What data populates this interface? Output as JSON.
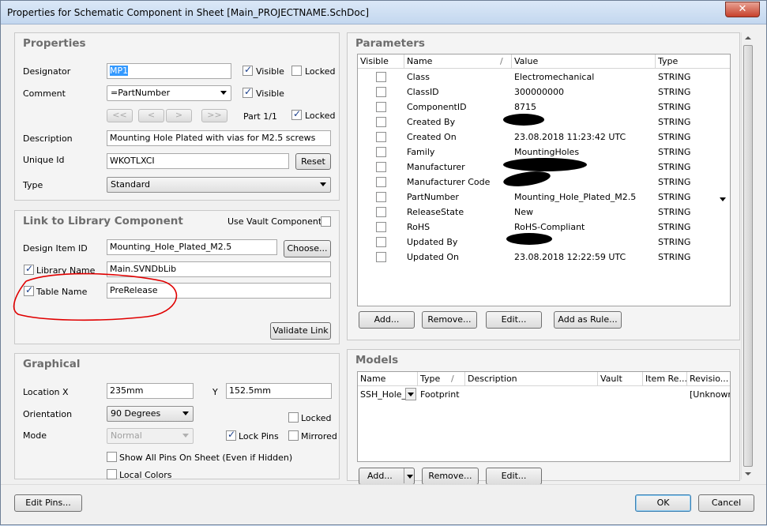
{
  "window": {
    "title": "Properties for Schematic Component in Sheet [Main_PROJECTNAME.SchDoc]",
    "close": "✕"
  },
  "properties": {
    "title": "Properties",
    "designator_label": "Designator",
    "designator_value": "MP1",
    "visible_label": "Visible",
    "locked_label": "Locked",
    "comment_label": "Comment",
    "comment_value": "=PartNumber",
    "nav": [
      "<<",
      "<",
      ">",
      ">>"
    ],
    "part_label": "Part 1/1",
    "description_label": "Description",
    "description_value": "Mounting Hole Plated with vias for M2.5 screws",
    "uniqueid_label": "Unique Id",
    "uniqueid_value": "WKOTLXCI",
    "reset": "Reset",
    "type_label": "Type",
    "type_value": "Standard"
  },
  "library": {
    "title": "Link to Library Component",
    "use_vault": "Use Vault Component",
    "design_item_label": "Design Item ID",
    "design_item_value": "Mounting_Hole_Plated_M2.5",
    "choose": "Choose...",
    "library_name_label": "Library Name",
    "library_name_value": "Main.SVNDbLib",
    "table_name_label": "Table Name",
    "table_name_value": "PreRelease",
    "validate": "Validate Link"
  },
  "graphical": {
    "title": "Graphical",
    "location_label": "Location",
    "x_label": "X",
    "x_value": "235mm",
    "y_label": "Y",
    "y_value": "152.5mm",
    "orientation_label": "Orientation",
    "orientation_value": "90 Degrees",
    "locked_label": "Locked",
    "mode_label": "Mode",
    "mode_value": "Normal",
    "lockpins_label": "Lock Pins",
    "mirrored_label": "Mirrored",
    "showpins_label": "Show All Pins On Sheet (Even if Hidden)",
    "localcolors_label": "Local Colors"
  },
  "parameters": {
    "title": "Parameters",
    "columns": [
      "Visible",
      "Name",
      "Value",
      "Type"
    ],
    "sort_indicator": "/",
    "rows": [
      {
        "name": "Class",
        "value": "Electromechanical",
        "type": "STRING"
      },
      {
        "name": "ClassID",
        "value": "300000000",
        "type": "STRING"
      },
      {
        "name": "ComponentID",
        "value": "8715",
        "type": "STRING"
      },
      {
        "name": "Created By",
        "value": "",
        "type": "STRING"
      },
      {
        "name": "Created On",
        "value": "23.08.2018 11:23:42 UTC",
        "type": "STRING"
      },
      {
        "name": "Family",
        "value": "MountingHoles",
        "type": "STRING"
      },
      {
        "name": "Manufacturer",
        "value": "",
        "type": "STRING"
      },
      {
        "name": "Manufacturer Code",
        "value": "",
        "type": "STRING"
      },
      {
        "name": "PartNumber",
        "value": "Mounting_Hole_Plated_M2.5",
        "type": "STRING"
      },
      {
        "name": "ReleaseState",
        "value": "New",
        "type": "STRING"
      },
      {
        "name": "RoHS",
        "value": "RoHS-Compliant",
        "type": "STRING"
      },
      {
        "name": "Updated By",
        "value": "",
        "type": "STRING"
      },
      {
        "name": "Updated On",
        "value": "23.08.2018 12:22:59 UTC",
        "type": "STRING"
      }
    ],
    "buttons": [
      "Add...",
      "Remove...",
      "Edit...",
      "Add as Rule..."
    ]
  },
  "models": {
    "title": "Models",
    "columns": [
      "Name",
      "Type",
      "Description",
      "Vault",
      "Item Re...",
      "Revisio..."
    ],
    "sort_indicator": "/",
    "rows": [
      {
        "name": "SSH_Hole_F",
        "type": "Footprint",
        "description": "",
        "vault": "",
        "item": "",
        "revision": "[Unknowr"
      }
    ],
    "buttons": [
      "Add...",
      "Remove...",
      "Edit..."
    ]
  },
  "footer": {
    "edit_pins": "Edit Pins...",
    "ok": "OK",
    "cancel": "Cancel"
  },
  "colors": {
    "annotation": "#e00000",
    "selection": "#3399ff"
  }
}
